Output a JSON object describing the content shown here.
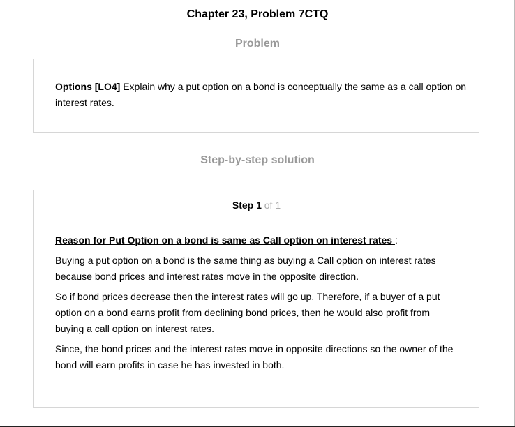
{
  "header": {
    "title": "Chapter 23, Problem 7CTQ"
  },
  "problem_section": {
    "heading": "Problem",
    "tag": "Options [LO4]",
    "text": " Explain why a put option on a bond is conceptually the same as a call option on interest rates."
  },
  "solution_section": {
    "heading": "Step-by-step solution",
    "step_word": "Step 1",
    "step_of": " of 1",
    "subheading": "Reason for Put Option on a bond is same as Call option on interest rates ",
    "subheading_suffix": ":",
    "paragraphs": [
      "Buying a put option on a bond is the same thing as buying a Call option on interest rates because bond prices and interest rates move in the opposite direction.",
      "So if bond prices decrease then the interest rates will go up. Therefore, if a buyer of a put option on a bond earns profit from declining bond prices, then he would also profit from buying a call option on interest rates.",
      "Since, the bond prices and the interest rates move in opposite directions so the owner of the bond will earn profits in case he has invested in both."
    ]
  }
}
